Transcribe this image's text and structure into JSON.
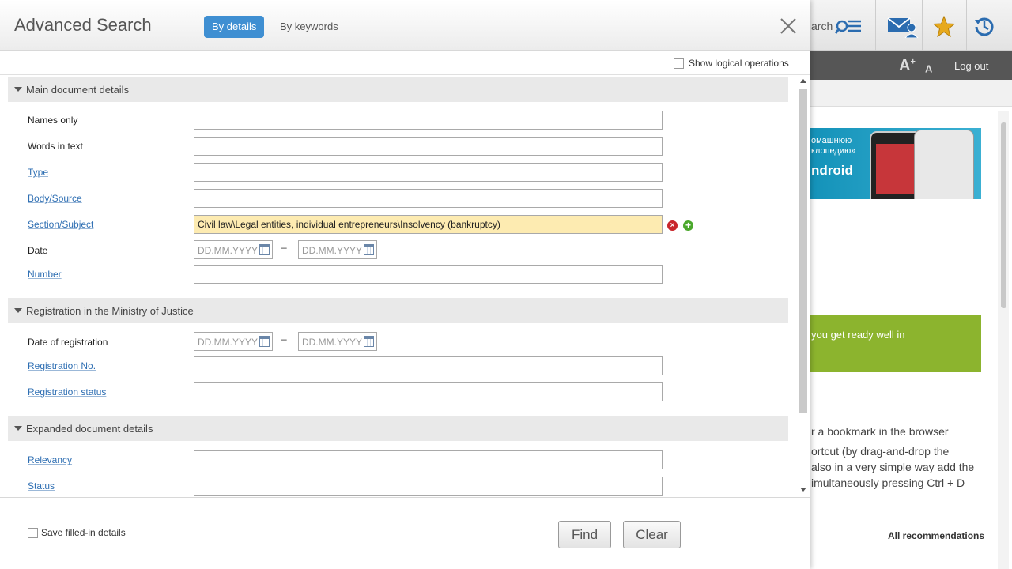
{
  "background": {
    "search_partial": "arch",
    "font_increase": "A",
    "font_decrease": "A",
    "logout": "Log out",
    "promo_line1": "омашнюю",
    "promo_line2": "клопедию»",
    "promo_line3": "ndroid",
    "green_text": "you get ready well in",
    "text_lines": [
      "r a bookmark in the browser",
      "ortcut (by drag-and-drop the",
      "also in a very simple way add the",
      "imultaneously pressing Ctrl + D"
    ],
    "all_recommendations": "All recommendations"
  },
  "modal": {
    "title": "Advanced Search",
    "tabs": [
      {
        "label": "By details",
        "active": true
      },
      {
        "label": "By keywords",
        "active": false
      }
    ],
    "show_logical_operations": "Show logical operations",
    "sections": [
      {
        "title": "Main document details"
      },
      {
        "title": "Registration in the Ministry of Justice"
      },
      {
        "title": "Expanded document details"
      }
    ],
    "fields": {
      "names_only": {
        "label": "Names only",
        "value": ""
      },
      "words_in_text": {
        "label": "Words in text",
        "value": ""
      },
      "type": {
        "label": "Type",
        "value": ""
      },
      "body_source": {
        "label": "Body/Source",
        "value": ""
      },
      "section_subject": {
        "label": "Section/Subject",
        "value": "Civil law\\Legal entities, individual entrepreneurs\\Insolvency (bankruptcy)"
      },
      "date": {
        "label": "Date",
        "from_placeholder": "DD.MM.YYYY",
        "to_placeholder": "DD.MM.YYYY",
        "separator": "–"
      },
      "number": {
        "label": "Number",
        "value": ""
      },
      "date_of_registration": {
        "label": "Date of registration",
        "from_placeholder": "DD.MM.YYYY",
        "to_placeholder": "DD.MM.YYYY",
        "separator": "–"
      },
      "registration_no": {
        "label": "Registration No.",
        "value": ""
      },
      "registration_status": {
        "label": "Registration status",
        "value": ""
      },
      "relevancy": {
        "label": "Relevancy",
        "value": ""
      },
      "status": {
        "label": "Status",
        "value": ""
      }
    },
    "footer": {
      "save_filled": "Save filled-in details",
      "find": "Find",
      "clear": "Clear"
    }
  },
  "colors": {
    "accent": "#3f8fd2",
    "filled_field": "#fdebb1",
    "link": "#2f6fb3",
    "section_bg": "#e9e9e9"
  }
}
